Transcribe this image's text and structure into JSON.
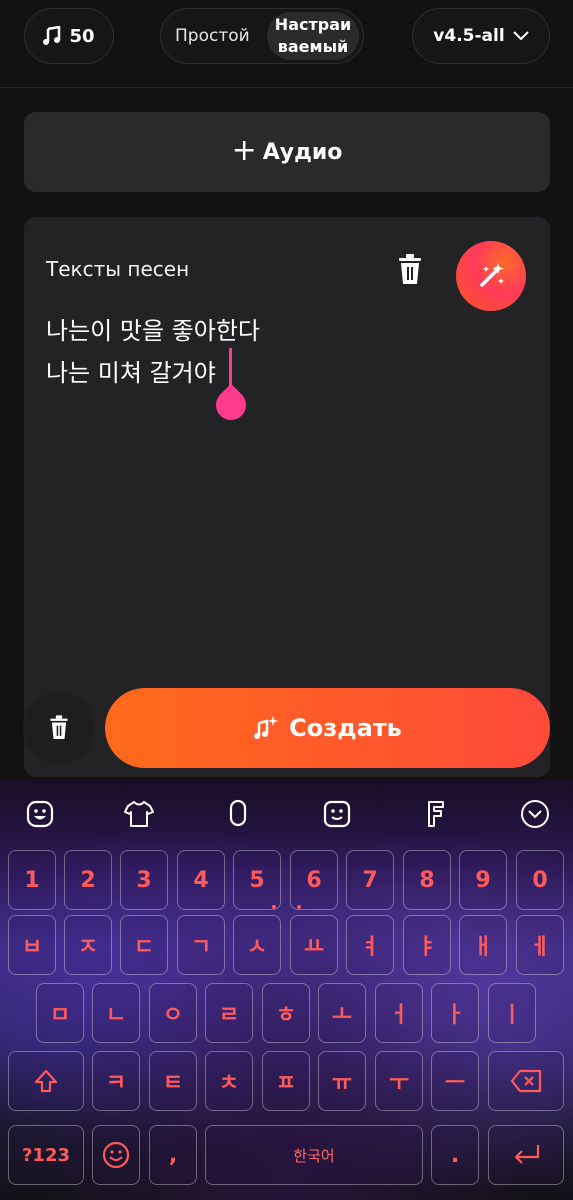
{
  "header": {
    "credits": "50",
    "mode_simple": "Простой",
    "mode_custom_line1": "Настраи",
    "mode_custom_line2": "ваемый",
    "model": "v4.5-all"
  },
  "add_audio_label": "Аудио",
  "lyrics": {
    "title": "Тексты песен",
    "line1": "나는이 맛을 좋아한다",
    "line2": "나는 미쳐 갈거야"
  },
  "create_label": "Создать",
  "keyboard": {
    "numbers": [
      "1",
      "2",
      "3",
      "4",
      "5",
      "6",
      "7",
      "8",
      "9",
      "0"
    ],
    "row1": [
      "ㅂ",
      "ㅈ",
      "ㄷ",
      "ㄱ",
      "ㅅ",
      "ㅛ",
      "ㅕ",
      "ㅑ",
      "ㅐ",
      "ㅔ"
    ],
    "row2": [
      "ㅁ",
      "ㄴ",
      "ㅇ",
      "ㄹ",
      "ㅎ",
      "ㅗ",
      "ㅓ",
      "ㅏ",
      "ㅣ"
    ],
    "row3": [
      "ㅋ",
      "ㅌ",
      "ㅊ",
      "ㅍ",
      "ㅠ",
      "ㅜ",
      "ㅡ"
    ],
    "sym_label": "?123",
    "comma": ",",
    "space_label": "한국어",
    "period": ".",
    "icons": [
      "sticker-icon",
      "shirt-icon",
      "mic-icon",
      "emoji-icon",
      "font-icon",
      "collapse-icon",
      "shift-icon",
      "backspace-icon",
      "enter-icon"
    ]
  },
  "colors": {
    "accent": "#ff3b8e",
    "create": "#ff5a2a",
    "key_text": "#ff5a5a"
  }
}
